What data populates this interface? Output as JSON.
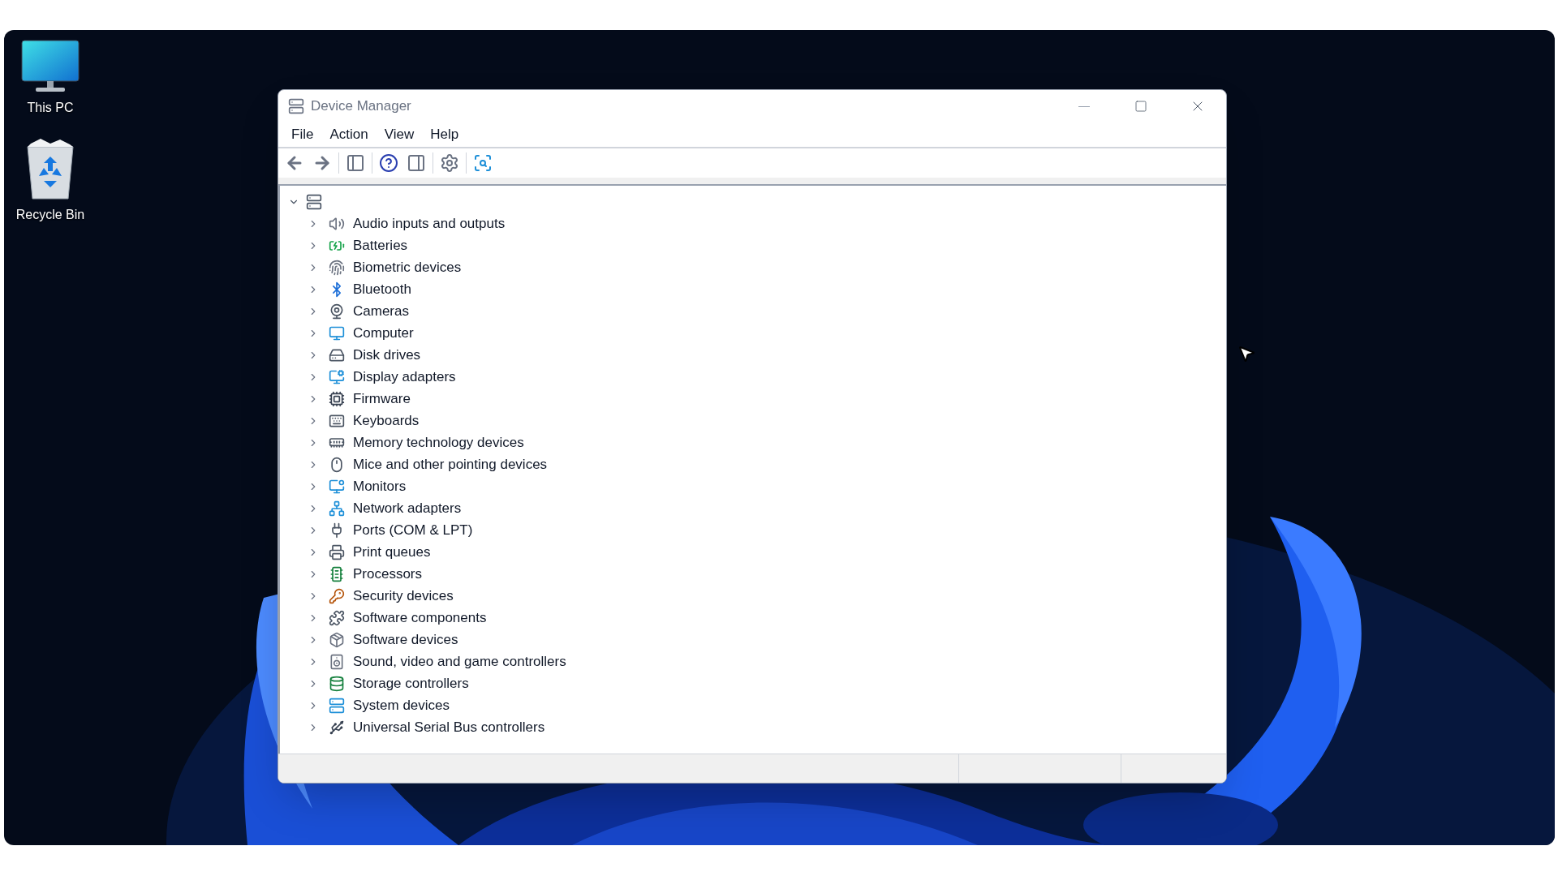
{
  "desktop_icons": [
    {
      "label": "This PC",
      "kind": "monitor"
    },
    {
      "label": "Recycle Bin",
      "kind": "bin"
    }
  ],
  "window": {
    "title": "Device Manager"
  },
  "menu": [
    "File",
    "Action",
    "View",
    "Help"
  ],
  "tree": {
    "expanded": true,
    "children": [
      {
        "label": "Audio inputs and outputs",
        "expanded": false
      },
      {
        "label": "Batteries",
        "expanded": false
      },
      {
        "label": "Biometric devices",
        "expanded": false
      },
      {
        "label": "Bluetooth",
        "expanded": false
      },
      {
        "label": "Cameras",
        "expanded": false
      },
      {
        "label": "Computer",
        "expanded": false
      },
      {
        "label": "Disk drives",
        "expanded": false
      },
      {
        "label": "Display adapters",
        "expanded": false
      },
      {
        "label": "Firmware",
        "expanded": false
      },
      {
        "label": "Keyboards",
        "expanded": false
      },
      {
        "label": "Memory technology devices",
        "expanded": false
      },
      {
        "label": "Mice and other pointing devices",
        "expanded": false
      },
      {
        "label": "Monitors",
        "expanded": false
      },
      {
        "label": "Network adapters",
        "expanded": false
      },
      {
        "label": "Ports (COM & LPT)",
        "expanded": false
      },
      {
        "label": "Print queues",
        "expanded": false
      },
      {
        "label": "Processors",
        "expanded": false
      },
      {
        "label": "Security devices",
        "expanded": false
      },
      {
        "label": "Software components",
        "expanded": false
      },
      {
        "label": "Software devices",
        "expanded": false
      },
      {
        "label": "Sound, video and game controllers",
        "expanded": false
      },
      {
        "label": "Storage controllers",
        "expanded": false
      },
      {
        "label": "System devices",
        "expanded": false
      },
      {
        "label": "Universal Serial Bus controllers",
        "expanded": false
      }
    ]
  }
}
